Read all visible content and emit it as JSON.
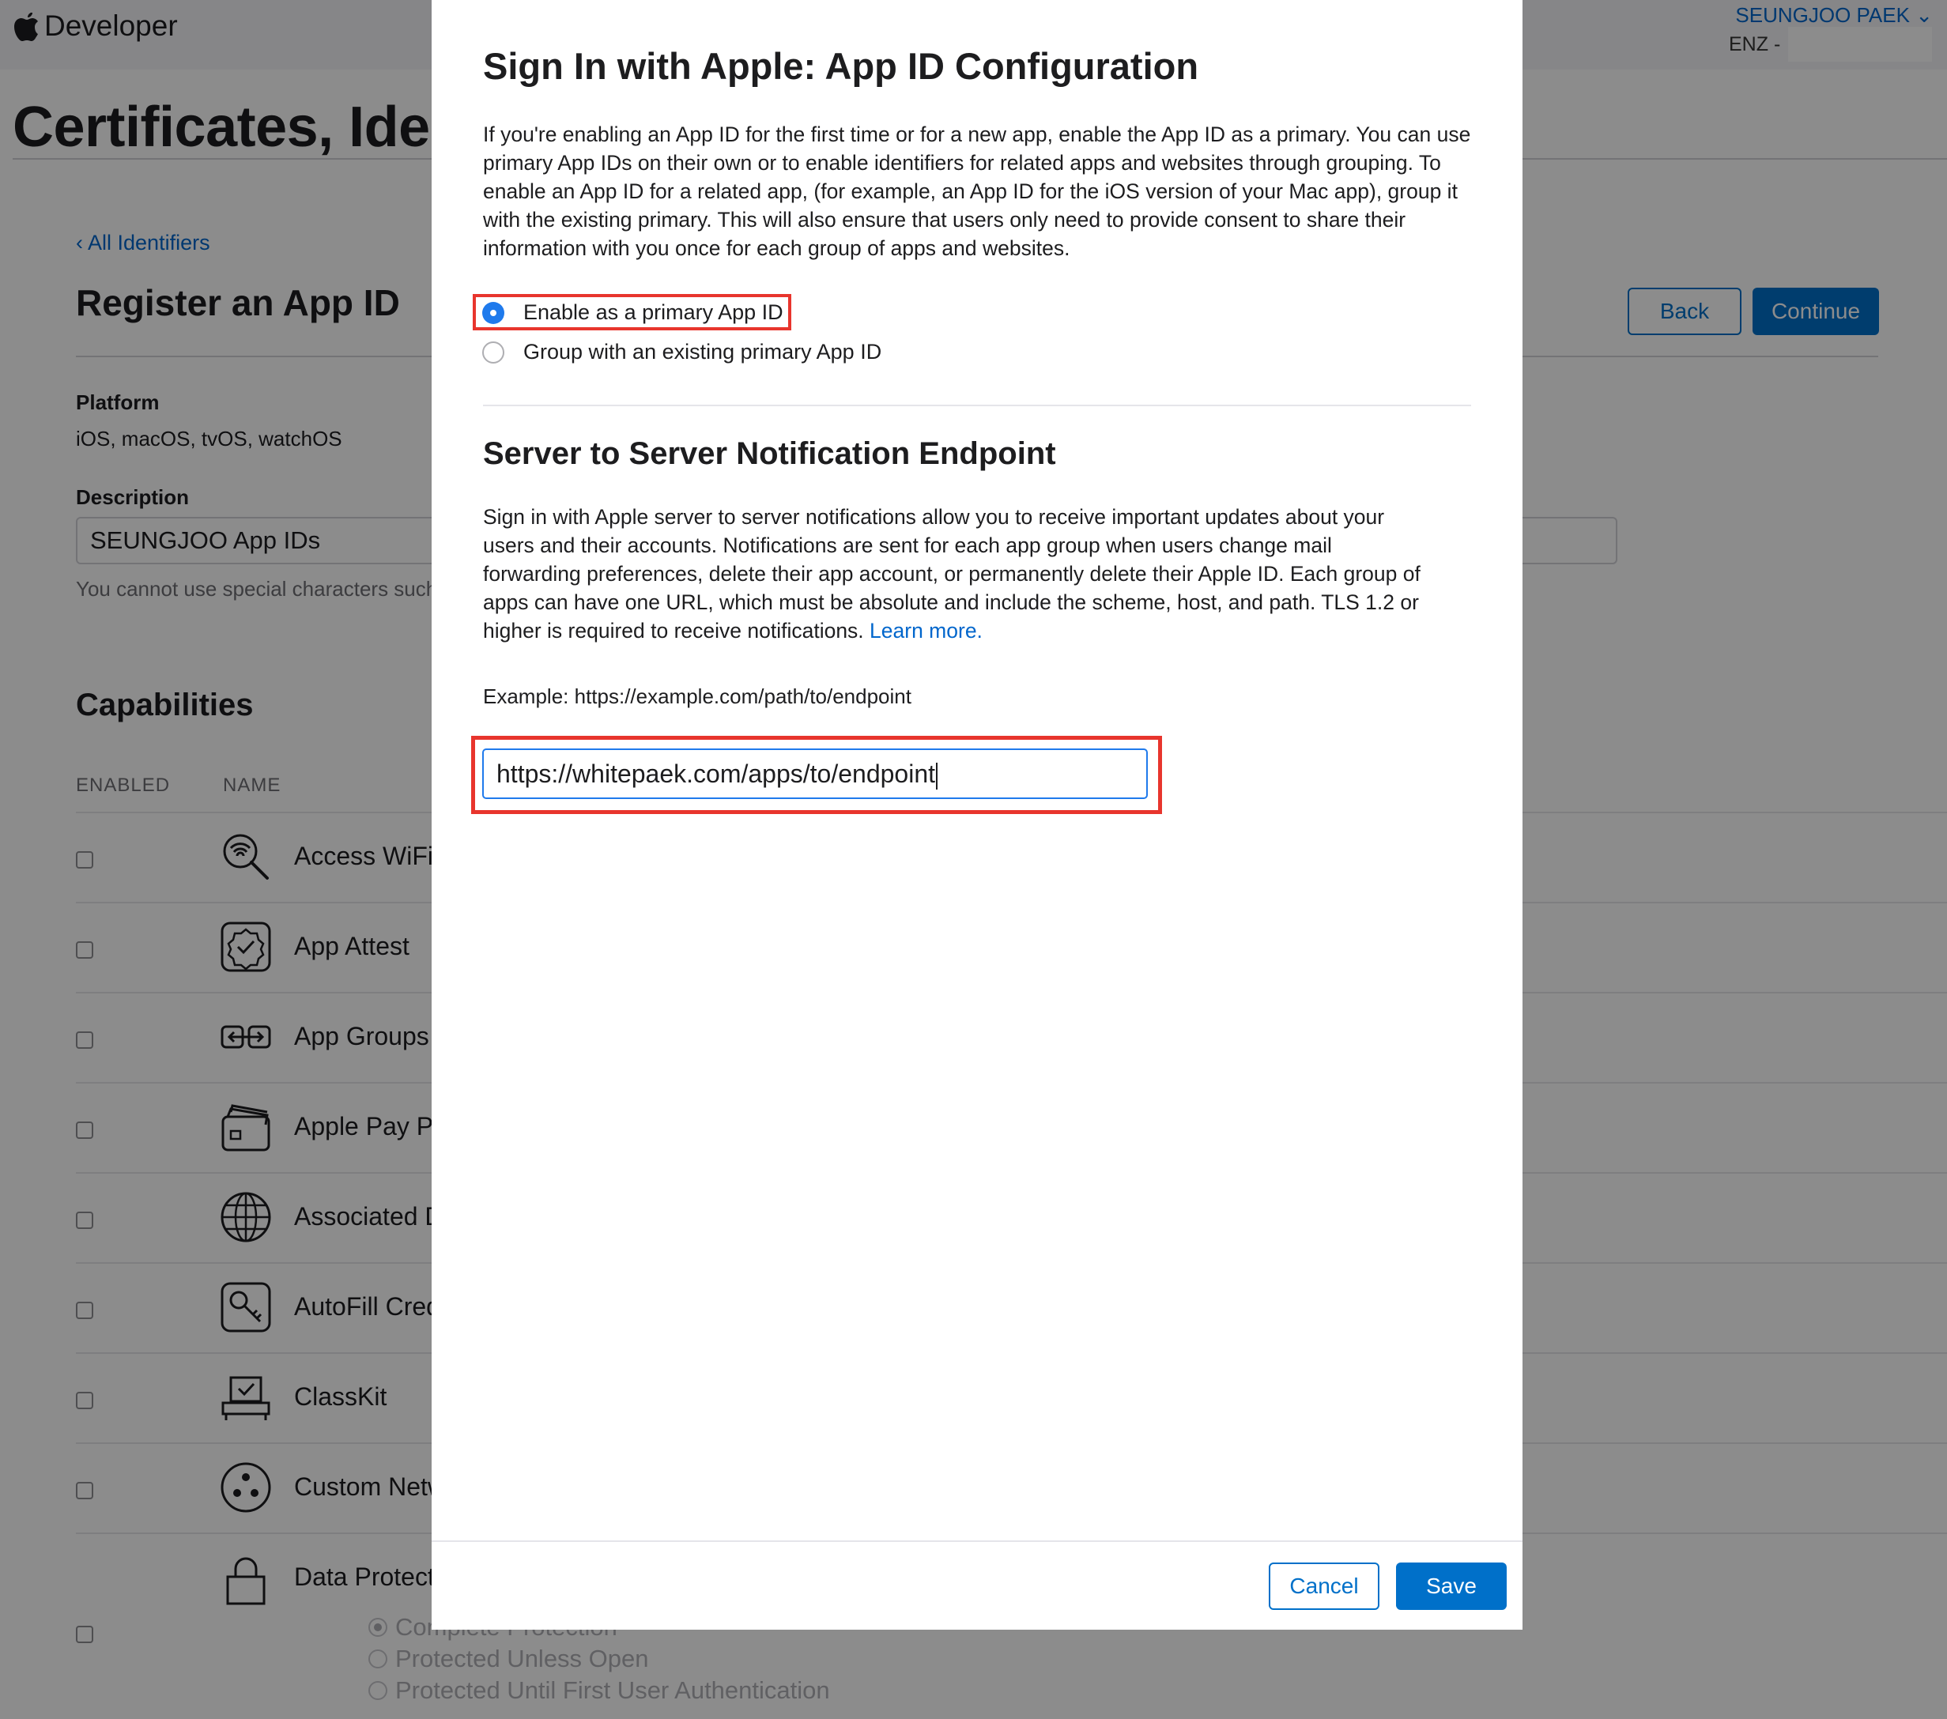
{
  "header": {
    "brand": "Developer",
    "account_name": "SEUNGJOO PAEK",
    "team": "ENZ -"
  },
  "page": {
    "title": "Certificates, Identifiers & Profiles",
    "back_link": "All Identifiers",
    "register_title": "Register an App ID",
    "back_button": "Back",
    "continue_button": "Continue",
    "platform_label": "Platform",
    "platform_value": "iOS, macOS, tvOS, watchOS",
    "description_label": "Description",
    "description_value": "SEUNGJOO App IDs",
    "description_help": "You cannot use special characters such as @, &, *, ', \""
  },
  "capabilities": {
    "title": "Capabilities",
    "col_enabled": "ENABLED",
    "col_name": "NAME",
    "items": [
      {
        "name": "Access WiFi Information",
        "icon": "wifi-search-icon"
      },
      {
        "name": "App Attest",
        "icon": "badge-check-icon"
      },
      {
        "name": "App Groups",
        "icon": "app-groups-icon"
      },
      {
        "name": "Apple Pay Payment Processing",
        "icon": "wallet-cards-icon"
      },
      {
        "name": "Associated Domains",
        "icon": "globe-icon"
      },
      {
        "name": "AutoFill Credential Provider",
        "icon": "key-icon"
      },
      {
        "name": "ClassKit",
        "icon": "classkit-icon"
      },
      {
        "name": "Custom Network Protocol",
        "icon": "network-icon"
      },
      {
        "name": "Data Protection",
        "icon": "lock-icon"
      }
    ],
    "data_protection_options": [
      "Complete Protection",
      "Protected Unless Open",
      "Protected Until First User Authentication"
    ]
  },
  "modal": {
    "title": "Sign In with Apple: App ID Configuration",
    "intro": "If you're enabling an App ID for the first time or for a new app, enable the App ID as a primary. You can use primary App IDs on their own or to enable identifiers for related apps and websites through grouping. To enable an App ID for a related app, (for example, an App ID for the iOS version of your Mac app), group it with the existing primary. This will also ensure that users only need to provide consent to share their information with you once for each group of apps and websites.",
    "option_primary": "Enable as a primary App ID",
    "option_group": "Group with an existing primary App ID",
    "selected_option": "Enable as a primary App ID",
    "section_title": "Server to Server Notification Endpoint",
    "section_text": "Sign in with Apple server to server notifications allow you to receive important updates about your users and their accounts. Notifications are sent for each app group when users change mail forwarding preferences, delete their app account, or permanently delete their Apple ID. Each group of apps can have one URL, which must be absolute and include the scheme, host, and path. TLS 1.2 or higher is required to receive notifications.",
    "learn_more": "Learn more.",
    "example": "Example: https://example.com/path/to/endpoint",
    "endpoint_value": "https://whitepaek.com/apps/to/endpoint",
    "cancel_button": "Cancel",
    "save_button": "Save"
  },
  "colors": {
    "accent": "#0070c9",
    "link": "#0066cc",
    "highlight": "#e8352d",
    "radio_selected": "#1f7aec"
  }
}
